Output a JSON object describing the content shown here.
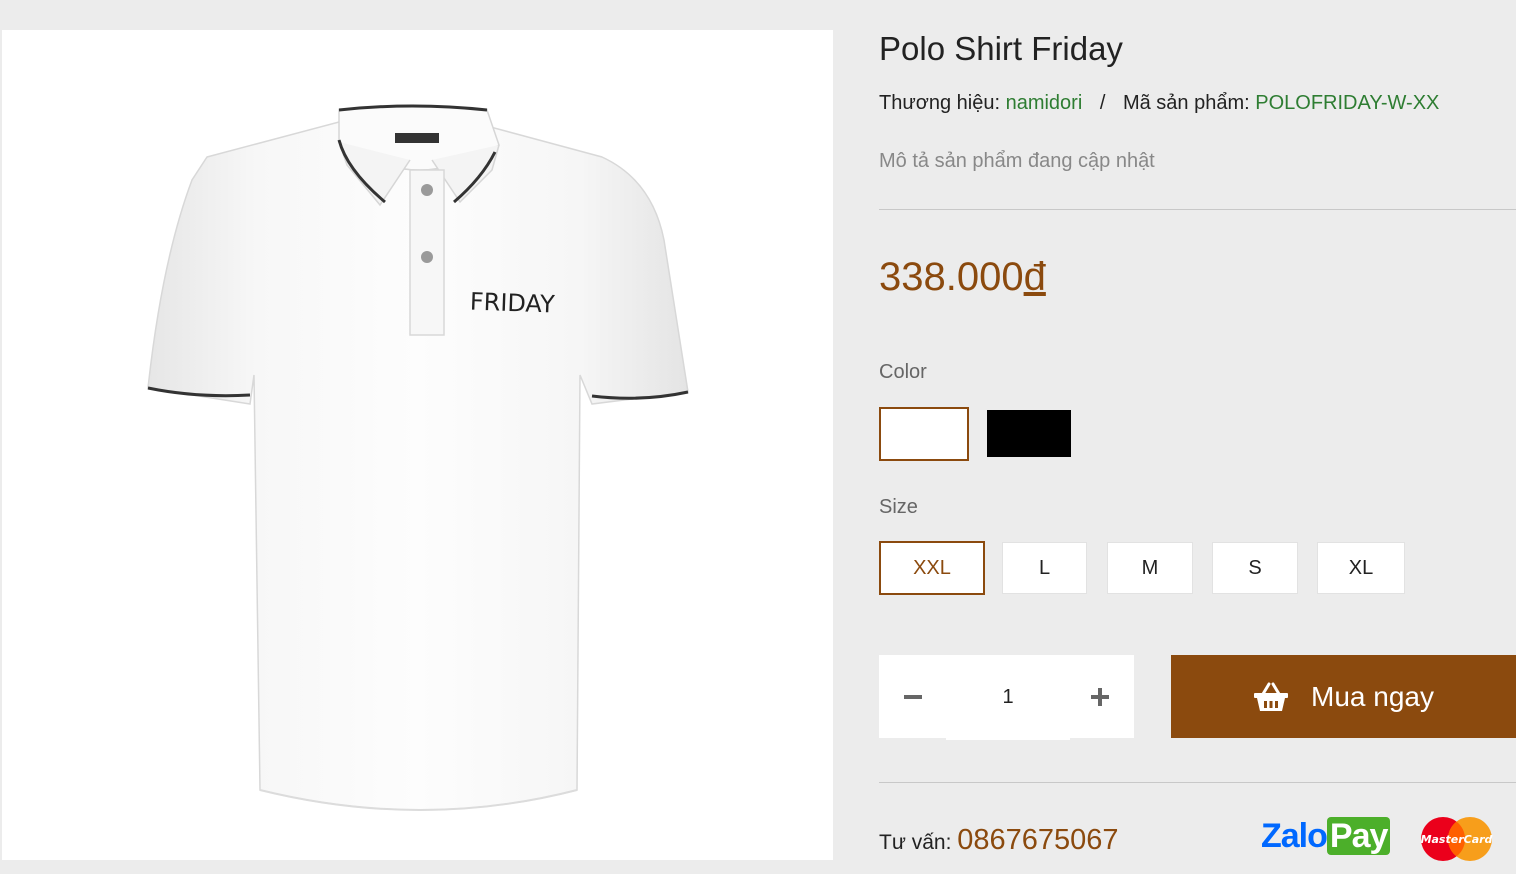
{
  "product": {
    "title": "Polo Shirt Friday",
    "brand_label": "Thương hiệu:",
    "brand_value": "namidori",
    "separator": "/",
    "sku_label": "Mã sản phẩm:",
    "sku_value": "POLOFRIDAY-W-XX",
    "description": "Mô tả sản phẩm đang cập nhật",
    "price_amount": "338.000",
    "price_currency": "đ",
    "shirt_print": "FRIDAY"
  },
  "options": {
    "color_label": "Color",
    "colors": [
      {
        "name": "white",
        "hex": "#ffffff",
        "selected": true
      },
      {
        "name": "black",
        "hex": "#000000",
        "selected": false
      }
    ],
    "size_label": "Size",
    "sizes": [
      "XXL",
      "L",
      "M",
      "S",
      "XL"
    ],
    "selected_size": "XXL"
  },
  "cart": {
    "quantity": "1",
    "minus_icon": "minus-icon",
    "plus_icon": "plus-icon",
    "buy_label": "Mua ngay",
    "buy_icon": "basket-icon"
  },
  "footer": {
    "hotline_label": "Tư vấn:",
    "hotline_number": "0867675067",
    "zalopay_zalo": "Zalo",
    "zalopay_pay": "Pay",
    "mastercard_text": "MasterCard"
  },
  "colors": {
    "accent": "#8b4a0e",
    "green": "#2e7d32",
    "background": "#ececec"
  }
}
